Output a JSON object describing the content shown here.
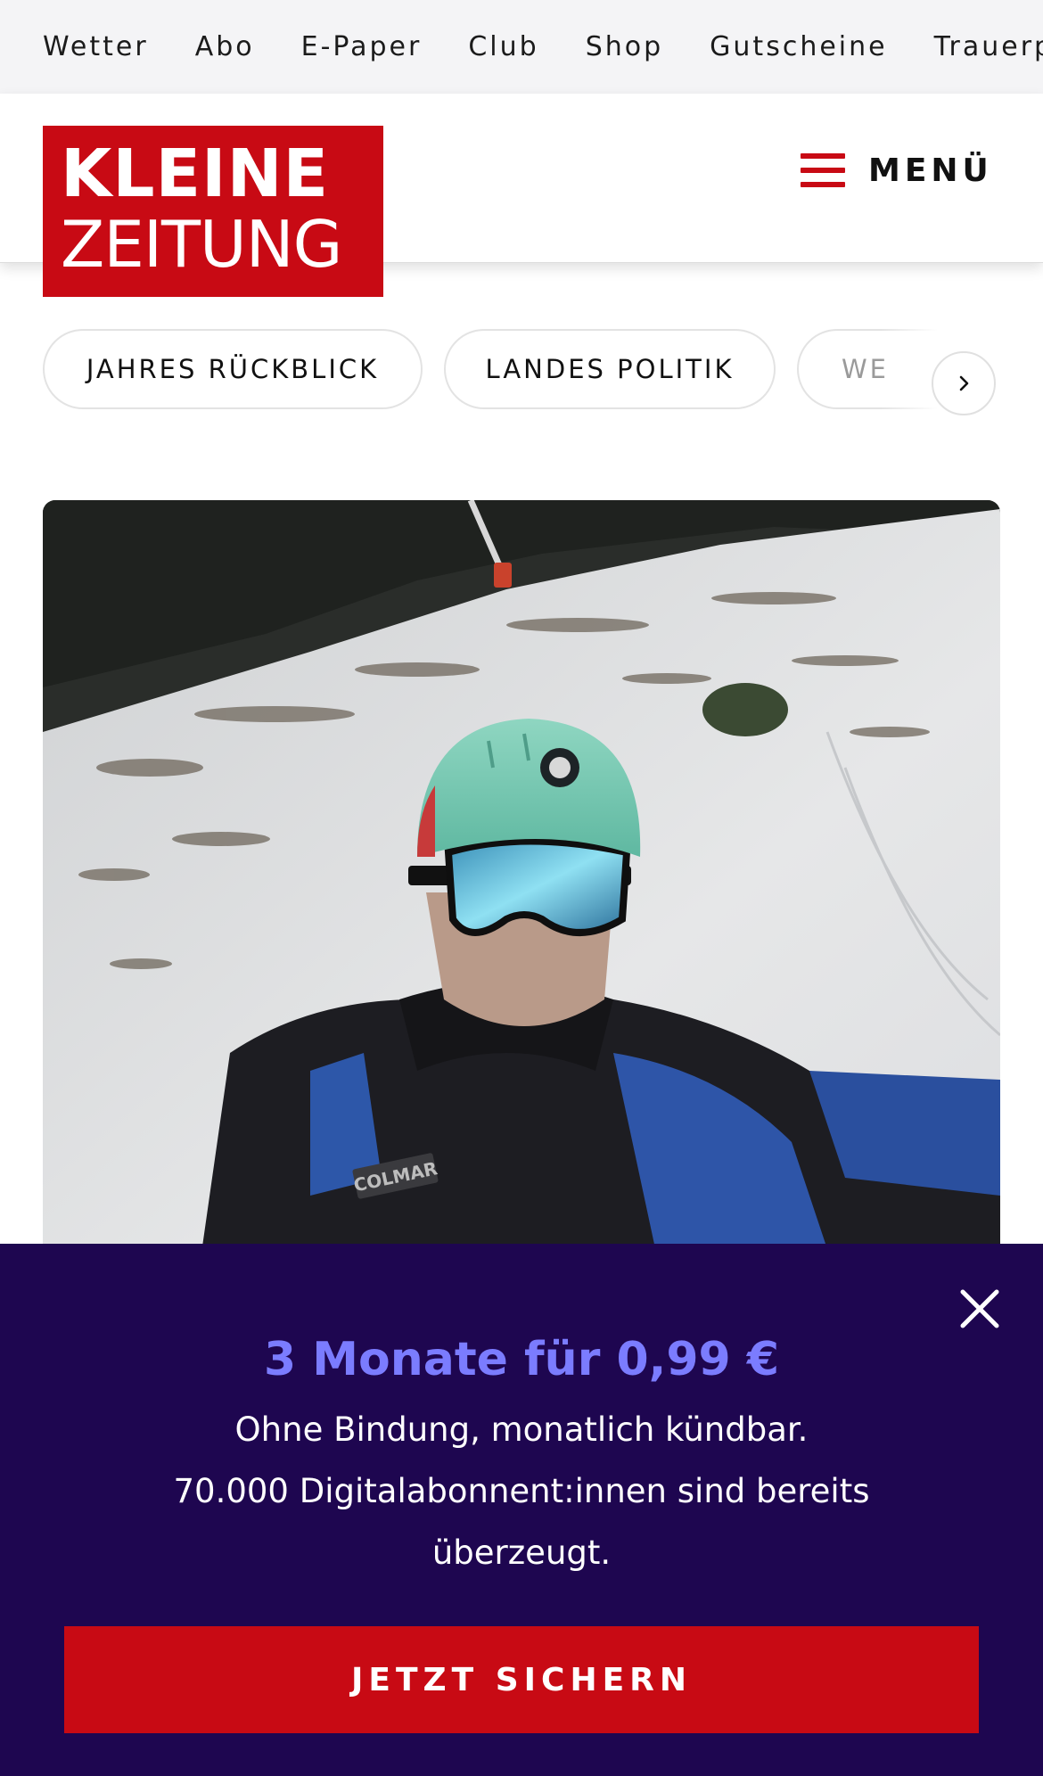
{
  "topnav": {
    "items": [
      "Wetter",
      "Abo",
      "E-Paper",
      "Club",
      "Shop",
      "Gutscheine",
      "Trauerpo"
    ]
  },
  "header": {
    "logo_line1": "KLEINE",
    "logo_line2": "ZEITUNG",
    "menu_label": "MENÜ",
    "brand_color": "#c80a14"
  },
  "topics": {
    "pills": [
      "JAHRES RÜCKBLICK",
      "LANDES POLITIK",
      "WE"
    ],
    "next_icon": "chevron-right-icon"
  },
  "hero": {
    "jacket_patch": "COLMAR"
  },
  "subscription_overlay": {
    "offer": "3 Monate für 0,99 €",
    "line1": "Ohne Bindung, monatlich kündbar.",
    "line2": "70.000 Digitalabonnent:innen sind bereits",
    "line3": "überzeugt.",
    "cta": "JETZT SICHERN",
    "close_icon": "close-icon",
    "background_color": "#1e0650",
    "accent_color": "#7b7cff"
  }
}
